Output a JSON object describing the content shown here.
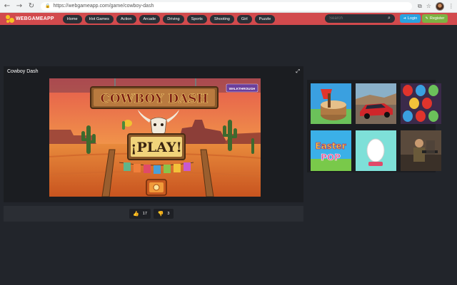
{
  "browser": {
    "url": "https://webgameapp.com/game/cowboy-dash"
  },
  "site": {
    "logo_text": "WEBGAMEAPP",
    "menu": [
      "Home",
      "Hot Games",
      "Action",
      "Arcade",
      "Driving",
      "Sports",
      "Shooting",
      "Girl",
      "Puzzle"
    ],
    "search_placeholder": "Search",
    "login_label": "Login",
    "register_label": "Register",
    "colors": {
      "header": "#d24a4d",
      "login": "#29a3e0",
      "register": "#7cb342"
    }
  },
  "game": {
    "title": "Cowboy Dash",
    "logo_text": "COWBOY DASH",
    "walkthrough_label": "WALKTHROUGH",
    "play_label": "¡PLAY!",
    "likes": "17",
    "dislikes": "3"
  },
  "sidebar": {
    "thumbs": [
      {
        "name": "axe-game"
      },
      {
        "name": "car-game"
      },
      {
        "name": "eggs-game"
      },
      {
        "name": "easter-pop",
        "text1": "Easter",
        "text2": "POP"
      },
      {
        "name": "egg-game"
      },
      {
        "name": "soldier-game"
      }
    ]
  }
}
